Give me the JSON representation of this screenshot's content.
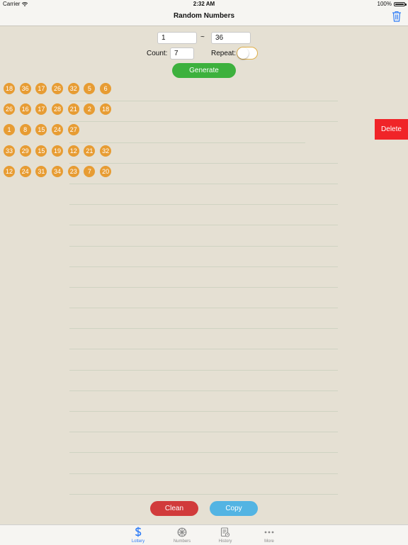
{
  "status": {
    "carrier": "Carrier",
    "time": "2:32 AM",
    "battery": "100%"
  },
  "nav": {
    "title": "Random Numbers"
  },
  "form": {
    "from_value": "1",
    "tilde": "~",
    "to_value": "36",
    "count_label": "Count:",
    "count_value": "7",
    "repeat_label": "Repeat:",
    "repeat_on": false,
    "generate_label": "Generate"
  },
  "results": [
    [
      "18",
      "36",
      "17",
      "26",
      "32",
      "5",
      "6"
    ],
    [
      "26",
      "16",
      "17",
      "28",
      "21",
      "2",
      "18"
    ],
    [
      "1",
      "8",
      "15",
      "24",
      "27"
    ],
    [
      "33",
      "29",
      "15",
      "19",
      "12",
      "21",
      "32"
    ],
    [
      "12",
      "24",
      "31",
      "34",
      "23",
      "7",
      "20"
    ]
  ],
  "delete_label": "Delete",
  "actions": {
    "clean_label": "Clean",
    "copy_label": "Copy"
  },
  "tabs": [
    {
      "label": "Lottery",
      "icon": "dollar-icon",
      "active": true
    },
    {
      "label": "Numbers",
      "icon": "wheel-icon",
      "active": false
    },
    {
      "label": "History",
      "icon": "history-icon",
      "active": false
    },
    {
      "label": "More",
      "icon": "more-icon",
      "active": false
    }
  ],
  "colors": {
    "background": "#e5e0d3",
    "ball": "#e79c33",
    "generate": "#3db13d",
    "delete": "#f02428",
    "clean": "#d13b3b",
    "copy": "#53b4e3",
    "active_tab": "#2f7cf6"
  }
}
